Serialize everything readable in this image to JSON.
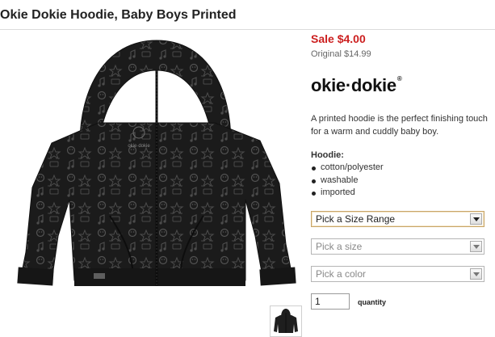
{
  "product": {
    "title": "Okie Dokie Hoodie, Baby Boys Printed",
    "sale_price": "Sale $4.00",
    "original_price": "Original $14.99",
    "brand": "okie·dokie",
    "brand_mark": "®",
    "description": "A printed hoodie is the perfect finishing touch for a warm and cuddly baby boy.",
    "details_heading": "Hoodie:",
    "details": [
      "cotton/polyester",
      "washable",
      "imported"
    ],
    "image_graphic_text": "okie·dokie"
  },
  "options": {
    "size_range": "Pick a Size Range",
    "size": "Pick a size",
    "color": "Pick a color"
  },
  "quantity": {
    "value": "1",
    "label": "quantity"
  },
  "colors": {
    "sale_red": "#cc1f1f",
    "hoodie_black": "#1a1a1a",
    "print_gray": "#4a4a4a"
  }
}
